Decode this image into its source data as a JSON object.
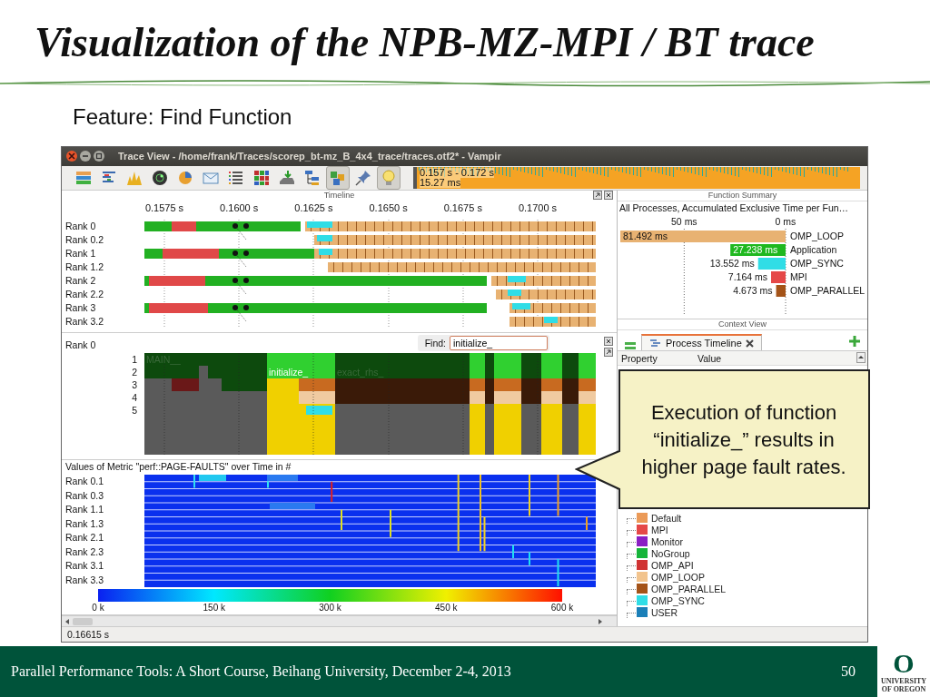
{
  "slide": {
    "title": "Visualization of the NPB-MZ-MPI / BT trace",
    "subtitle": "Feature: Find Function",
    "footer": "Parallel Performance Tools: A Short Course, Beihang University, December 2-4, 2013",
    "page": "50",
    "logo": {
      "letter": "O",
      "line1": "UNIVERSITY",
      "line2": "OF OREGON"
    }
  },
  "window": {
    "title": "Trace View - /home/frank/Traces/scorep_bt-mz_B_4x4_trace/traces.otf2* - Vampir"
  },
  "toolbar": [
    {
      "kind": "timeline",
      "pressed": false
    },
    {
      "kind": "process",
      "pressed": false
    },
    {
      "kind": "counter",
      "pressed": false
    },
    {
      "kind": "radar",
      "pressed": false
    },
    {
      "kind": "pie",
      "pressed": false
    },
    {
      "kind": "message",
      "pressed": false
    },
    {
      "kind": "list",
      "pressed": false
    },
    {
      "kind": "matrix",
      "pressed": false
    },
    {
      "kind": "io",
      "pressed": false
    },
    {
      "kind": "calltree",
      "pressed": false
    },
    {
      "kind": "group",
      "pressed": true
    },
    {
      "kind": "pin",
      "pressed": false
    },
    {
      "kind": "bulb",
      "pressed": true
    }
  ],
  "overview": {
    "range": "0.157 s - 0.172 s",
    "duration": "15.27 ms"
  },
  "timeline": {
    "title": "Timeline",
    "ticks": [
      "0.1575 s",
      "0.1600 s",
      "0.1625 s",
      "0.1650 s",
      "0.1675 s",
      "0.1700 s"
    ],
    "ranks": [
      "Rank 0",
      "Rank 0.2",
      "Rank 1",
      "Rank 1.2",
      "Rank 2",
      "Rank 2.2",
      "Rank 3",
      "Rank 3.2"
    ]
  },
  "process_timeline": {
    "rank": "Rank 0",
    "find_label": "Find:",
    "find_value": "initialize_",
    "levels": [
      "1",
      "2",
      "3",
      "4",
      "5"
    ],
    "functions": [
      "MAIN__",
      "initialize_",
      "exact_rhs_"
    ]
  },
  "metric": {
    "title": "Values of Metric \"perf::PAGE-FAULTS\" over Time in #",
    "ranks": [
      "Rank 0.1",
      "Rank 0.3",
      "Rank 1.1",
      "Rank 1.3",
      "Rank 2.1",
      "Rank 2.3",
      "Rank 3.1",
      "Rank 3.3"
    ],
    "scale": [
      "0 k",
      "150 k",
      "300 k",
      "450 k",
      "600 k"
    ]
  },
  "function_summary": {
    "title": "Function Summary",
    "subtitle": "All Processes, Accumulated Exclusive Time per Fun…",
    "chart_data": {
      "type": "bar",
      "orientation": "horizontal",
      "xlim": [
        81.5,
        0
      ],
      "xticks": [
        {
          "value": 50,
          "label": "50 ms"
        },
        {
          "value": 0,
          "label": "0 ms"
        }
      ],
      "series": [
        {
          "name": "OMP_LOOP",
          "color": "#e8b272",
          "values": [
            81.492
          ]
        },
        {
          "name": "Application",
          "color": "#1fb81f",
          "values": [
            27.238
          ]
        },
        {
          "name": "OMP_SYNC",
          "color": "#30dde6",
          "values": [
            13.552
          ]
        },
        {
          "name": "MPI",
          "color": "#e54848",
          "values": [
            7.164
          ]
        },
        {
          "name": "OMP_PARALLEL",
          "color": "#a45318",
          "values": [
            4.673
          ]
        }
      ],
      "value_labels": [
        "81.492 ms",
        "27.238 ms",
        "13.552 ms",
        "7.164 ms",
        "4.673 ms"
      ]
    }
  },
  "context_view": {
    "title": "Context View",
    "tab": "Process Timeline",
    "columns": [
      "Property",
      "Value"
    ],
    "legend": [
      {
        "label": "Default",
        "color": "#eb9a58"
      },
      {
        "label": "MPI",
        "color": "#e54848"
      },
      {
        "label": "Monitor",
        "color": "#8a1fc4"
      },
      {
        "label": "NoGroup",
        "color": "#16b43a"
      },
      {
        "label": "OMP_API",
        "color": "#d03434"
      },
      {
        "label": "OMP_LOOP",
        "color": "#f2c48e"
      },
      {
        "label": "OMP_PARALLEL",
        "color": "#a45318"
      },
      {
        "label": "OMP_SYNC",
        "color": "#30dde6"
      },
      {
        "label": "USER",
        "color": "#1b7fb8"
      }
    ]
  },
  "callout": {
    "text": "Execution of function “initialize_” results in higher page fault rates."
  },
  "status_bar": {
    "time": "0.16615 s"
  }
}
